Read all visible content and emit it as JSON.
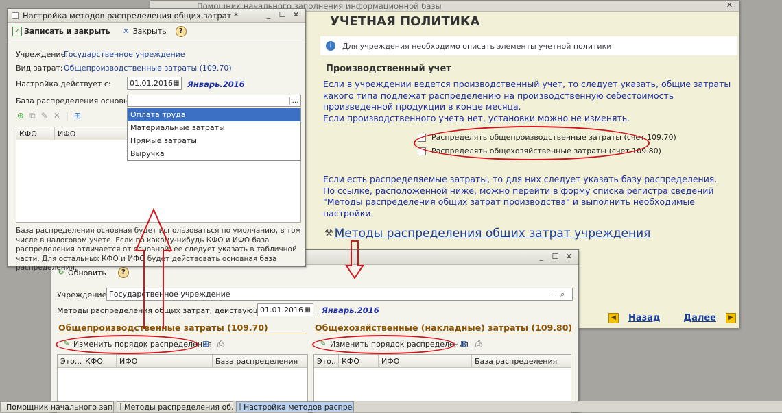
{
  "assistant": {
    "title": "Помощник начального заполнения информационной базы",
    "heading": "УЧЕТНАЯ ПОЛИТИКА",
    "info": "Для учреждения необходимо описать элементы учетной политики",
    "section": "Производственный учет",
    "para1": "Если в учреждении ведется производственный учет, то следует указать, общие затраты какого типа подлежат распределению на производственную себестоимость произведенной продукции в конце месяца.",
    "para1b": "Если производственного учета нет, установки можно не изменять.",
    "check1": "Распределять общепроизводственные затраты (счет 109.70)",
    "check2": "Распределять общехозяйственные затраты  (счет 109.80)",
    "para2": "Если есть распределяемые затраты, то для них следует указать базу распределения. По ссылке, расположенной ниже, можно перейти в форму списка регистра сведений \"Методы распределения общих затрат производства\" и выполнить необходимые настройки.",
    "link": "Методы распределения общих затрат учреждения",
    "back": "Назад",
    "next": "Далее"
  },
  "settings": {
    "title": "Настройка методов распределения общих затрат *",
    "save_close": "Записать и закрыть",
    "close": "Закрыть",
    "help": "?",
    "inst_label": "Учреждение:",
    "inst_value": "Государственное учреждение",
    "cost_label": "Вид затрат:",
    "cost_value": "Общепроизводственные затраты (109.70)",
    "date_label": "Настройка действует с:",
    "date_value": "01.01.2016",
    "period": "Январь.2016",
    "base_label": "База распределения основная:",
    "dropdown": [
      "Оплата труда",
      "Материальные затраты",
      "Прямые затраты",
      "Выручка"
    ],
    "col_kfo": "КФО",
    "col_ifo": "ИФО",
    "note": "База распределения основная будет использоваться по умолчанию, в том числе в налоговом учете. Если по какому-нибудь КФО и ИФО база распределения отличается от основной, ее следует указать в табличной части. Для остальных КФО и ИФО будет действовать основная база распределения."
  },
  "methods": {
    "refresh": "Обновить",
    "help": "?",
    "inst_label": "Учреждение:",
    "inst_value": "Государственное учреждение",
    "date_label": "Методы распределения общих затрат, действующие на:",
    "date_value": "01.01.2016",
    "period": "Январь.2016",
    "left_title": "Общепроизводственные затраты (109.70)",
    "right_title": "Общехозяйственные (накладные) затраты (109.80)",
    "change": "Изменить порядок распределения",
    "col_this": "Это...",
    "col_kfo": "КФО",
    "col_ifo": "ИФО",
    "col_base": "База распределения"
  },
  "taskbar": [
    "Помощник начального зап...",
    "Методы распределения об...",
    "Настройка методов распре..."
  ],
  "colors": {
    "highlight": "#d4141d",
    "link": "#1a3d9a",
    "selection": "#3a6fc4"
  }
}
